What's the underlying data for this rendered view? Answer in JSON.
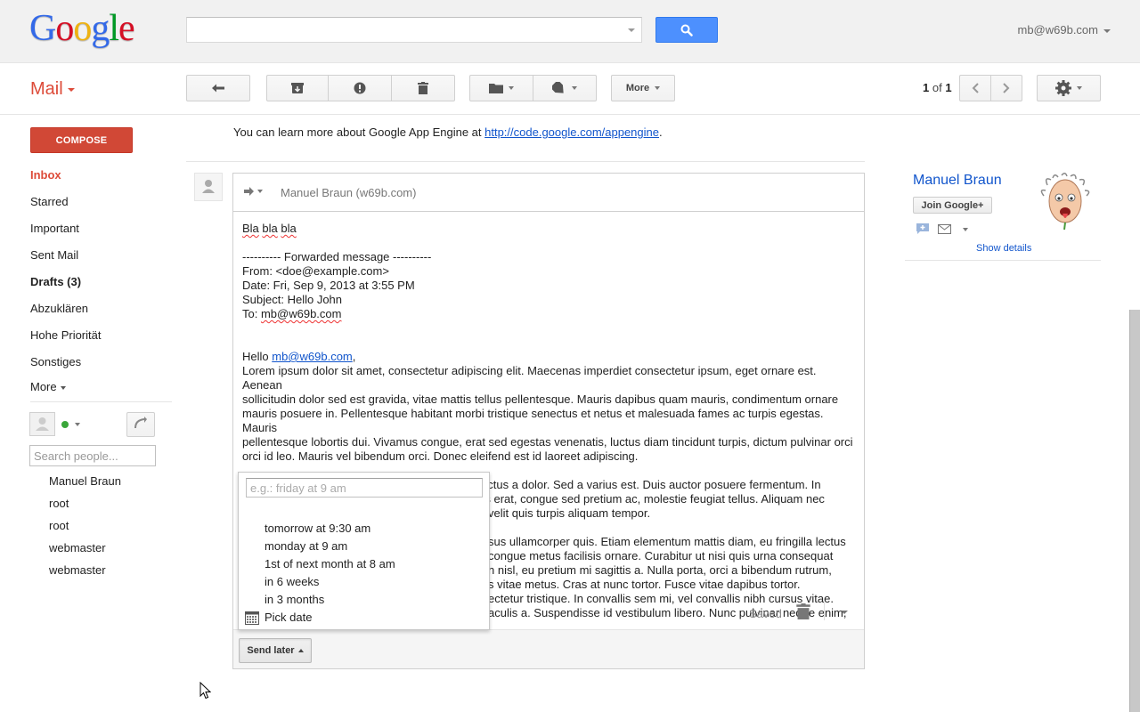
{
  "header": {
    "logo_letters": [
      {
        "ch": "G",
        "color": "#3369e8"
      },
      {
        "ch": "o",
        "color": "#d50f25"
      },
      {
        "ch": "o",
        "color": "#eeb211"
      },
      {
        "ch": "g",
        "color": "#3369e8"
      },
      {
        "ch": "l",
        "color": "#009925"
      },
      {
        "ch": "e",
        "color": "#d50f25"
      }
    ],
    "search_value": "",
    "account": "mb@w69b.com"
  },
  "toolbar": {
    "mail_label": "Mail",
    "more_label": "More",
    "pager_current": "1",
    "pager_sep": " of ",
    "pager_total": "1"
  },
  "nav": {
    "compose_label": "COMPOSE",
    "items": [
      {
        "label": "Inbox"
      },
      {
        "label": "Starred"
      },
      {
        "label": "Important"
      },
      {
        "label": "Sent Mail"
      },
      {
        "label": "Drafts (3)"
      },
      {
        "label": "Abzuklären"
      },
      {
        "label": "Hohe Priorität"
      },
      {
        "label": "Sonstiges"
      }
    ],
    "more_label": "More"
  },
  "chat": {
    "search_placeholder": "Search people...",
    "contacts": [
      "Manuel Braun",
      "root",
      "root",
      "webmaster",
      "webmaster"
    ]
  },
  "message": {
    "info_prefix": "You can learn more about Google App Engine at ",
    "info_link": "http://code.google.com/appengine",
    "info_suffix": ".",
    "to": "Manuel Braun (w69b.com)",
    "body": {
      "greeting_line": "Bla bla bla",
      "forward_header": "---------- Forwarded message ----------",
      "from": "From: <doe@example.com>",
      "date": "Date: Fri, Sep 9, 2013 at 3:55 PM",
      "subject": "Subject: Hello John",
      "to_prefix": "To: ",
      "to_addr": "mb@w69b.com",
      "hello_prefix": "Hello ",
      "hello_link": "mb@w69b.com",
      "hello_suffix": ",",
      "para1": [
        "Lorem ipsum dolor sit amet, consectetur adipiscing elit. Maecenas imperdiet consectetur ipsum, eget ornare est. Aenean",
        "sollicitudin dolor sed est gravida, vitae mattis tellus pellentesque. Mauris dapibus quam mauris, condimentum ornare",
        "mauris posuere in. Pellentesque habitant morbi tristique senectus et netus et malesuada fames ac turpis egestas. Mauris",
        "pellentesque lobortis dui. Vivamus congue, erat sed egestas venenatis, luctus diam tincidunt turpis, dictum pulvinar orci",
        "orci id leo. Mauris vel bibendum orci. Donec eleifend est id laoreet adipiscing."
      ],
      "para2": [
        "Fusce ipsum lacus, laoreet at posuere mattis, luctus a dolor. Sed a varius est. Duis auctor posuere fermentum. In",
        "pulvinar sit amet purus et interdum. Etiam metus erat, congue sed pretium ac, molestie feugiat tellus. Aliquam nec",
        "velit quis turpis aliquam tempor."
      ],
      "para3": [
        "sus ullamcorper quis. Etiam elementum mattis diam, eu fringilla lectus",
        "congue metus facilisis ornare. Curabitur ut nisi quis urna consequat",
        "n nisl, eu pretium mi sagittis a. Nulla porta, orci a bibendum rutrum,",
        "s vitae metus. Cras at nunc tortor. Fusce vitae dapibus tortor.",
        "ectetur tristique. In convallis sem mi, vel convallis nibh cursus vitae.",
        "aculis a. Suspendisse id vestibulum libero. Nunc pulvinar neque enim,"
      ]
    },
    "saved_label": "Saved",
    "send_later_label": "Send later"
  },
  "send_later_popup": {
    "input_placeholder": "e.g.: friday at 9 am",
    "options": [
      "tomorrow at 9:30 am",
      "monday at 9 am",
      "1st of next month at 8 am",
      "in 6 weeks",
      "in 3 months"
    ],
    "pick_date_label": "Pick date"
  },
  "contact_card": {
    "name": "Manuel Braun",
    "join_label": "Join Google+",
    "show_details": "Show details"
  }
}
